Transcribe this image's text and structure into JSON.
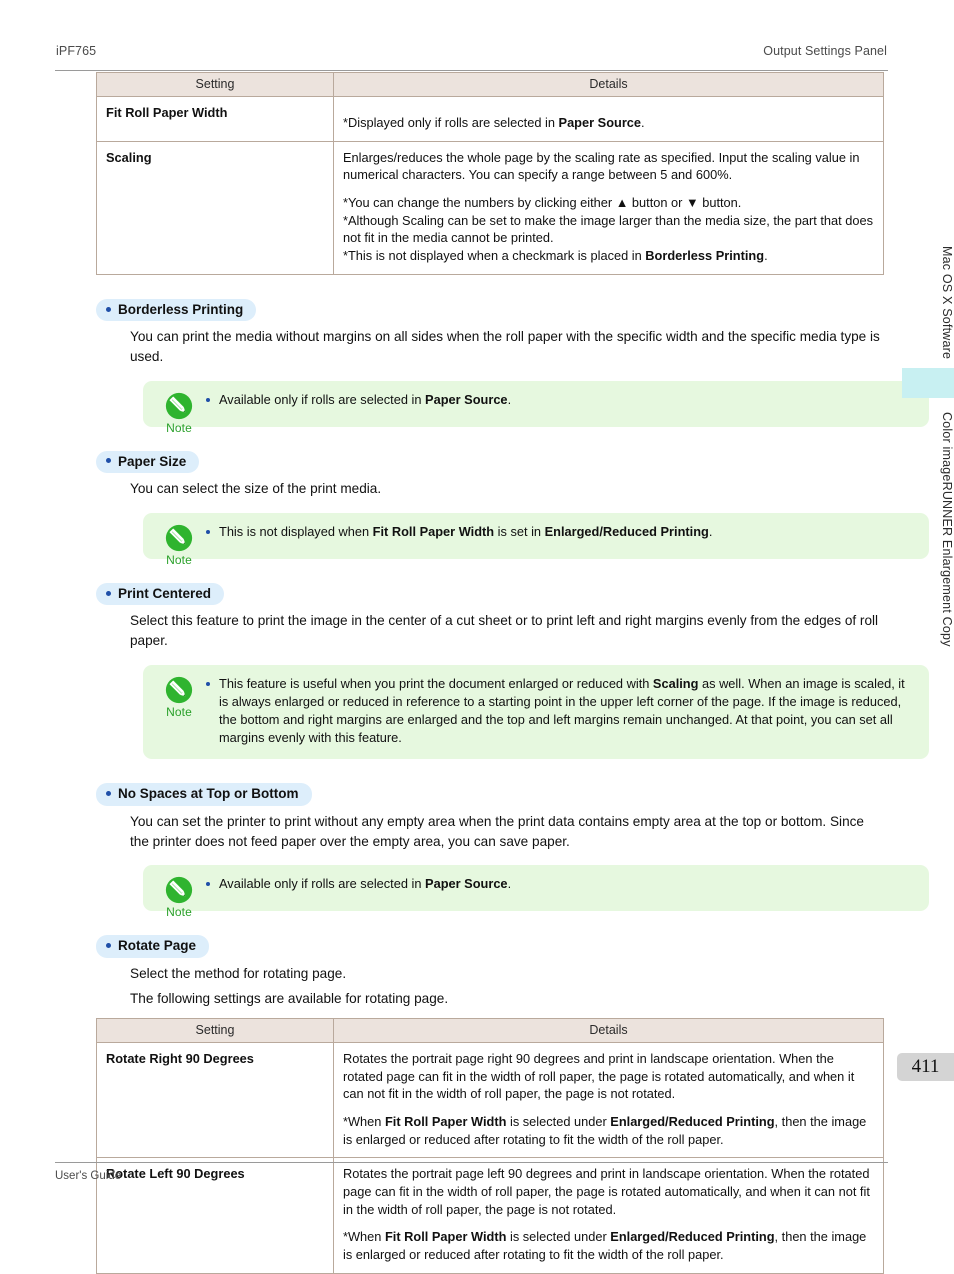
{
  "header": {
    "model": "iPF765",
    "section_title": "Output Settings Panel"
  },
  "footer": {
    "label": "User's Guide"
  },
  "side_rail": {
    "top_label": "Mac OS X Software",
    "bottom_label": "Color imageRUNNER Enlargement Copy",
    "page_number": "411",
    "tab_color": "#c8f0f2"
  },
  "table_top": {
    "columns": [
      "Setting",
      "Details"
    ],
    "rows": [
      {
        "setting": "Fit Roll Paper Width",
        "paragraphs": [
          [
            {
              "t": "*Displayed only if rolls are selected in "
            },
            {
              "t": "Paper Source",
              "b": true
            },
            {
              "t": "."
            }
          ]
        ]
      },
      {
        "setting": "Scaling",
        "paragraphs": [
          [
            {
              "t": "Enlarges/reduces the whole page by the scaling rate as specified. Input the scaling value in numerical characters. You can specify a range between 5 and 600%."
            }
          ],
          [
            {
              "t": "*You can change the numbers by clicking either ▲ button or ▼ button."
            }
          ],
          [
            {
              "t": "*Although Scaling can be set to make the image larger than the media size, the part that does not fit in the media cannot be printed."
            }
          ],
          [
            {
              "t": "*This is not displayed when a checkmark is placed in "
            },
            {
              "t": "Borderless Printing",
              "b": true
            },
            {
              "t": "."
            }
          ]
        ]
      }
    ]
  },
  "sections": [
    {
      "heading": "Borderless Printing",
      "body": "You can print the media without margins on all sides when the roll paper with the specific width and the specific media type is used.",
      "note": {
        "caption": "Note",
        "icon": "note-pencil-icon",
        "runs": [
          {
            "t": "Available only if rolls are selected in "
          },
          {
            "t": "Paper Source",
            "b": true
          },
          {
            "t": "."
          }
        ]
      }
    },
    {
      "heading": "Paper Size",
      "body": "You can select the size of the print media.",
      "note": {
        "caption": "Note",
        "icon": "note-pencil-icon",
        "runs": [
          {
            "t": "This is not displayed when "
          },
          {
            "t": "Fit Roll Paper Width",
            "b": true
          },
          {
            "t": " is set in "
          },
          {
            "t": "Enlarged/Reduced Printing",
            "b": true
          },
          {
            "t": "."
          }
        ]
      }
    },
    {
      "heading": "Print Centered",
      "body": "Select this feature to print the image in the center of a cut sheet or to print left and right margins evenly from the edges of roll paper.",
      "note": {
        "caption": "Note",
        "icon": "note-pencil-icon",
        "runs": [
          {
            "t": "This feature is useful when you print the document enlarged or reduced with "
          },
          {
            "t": "Scaling",
            "b": true
          },
          {
            "t": " as well. When an image is scaled, it is always enlarged or reduced in reference to a starting point in the upper left corner of the page. If the image is reduced, the bottom and right margins are enlarged and the top and left margins remain unchanged. At that point, you can set all margins evenly with this feature."
          }
        ]
      }
    },
    {
      "heading": "No Spaces at Top or Bottom",
      "body": "You can set the printer to print without any empty area when the print data contains empty area at the top or bottom. Since the printer does not feed paper over the empty area, you can save paper.",
      "note": {
        "caption": "Note",
        "icon": "note-pencil-icon",
        "runs": [
          {
            "t": "Available only if rolls are selected in "
          },
          {
            "t": "Paper Source",
            "b": true
          },
          {
            "t": "."
          }
        ]
      }
    },
    {
      "heading": "Rotate Page",
      "body": "Select the method for rotating page.",
      "body2": "The following settings are available for rotating page."
    }
  ],
  "table_bottom": {
    "columns": [
      "Setting",
      "Details"
    ],
    "rows": [
      {
        "setting": "Rotate Right 90 Degrees",
        "paragraphs": [
          [
            {
              "t": "Rotates the portrait page right 90 degrees and print in landscape orientation. When the rotated page can fit in the width of roll paper, the page is rotated automatically, and when it can not fit in the width of roll paper, the page is not rotated."
            }
          ],
          [
            {
              "t": "*When "
            },
            {
              "t": "Fit Roll Paper Width",
              "b": true
            },
            {
              "t": " is selected under "
            },
            {
              "t": "Enlarged/Reduced Printing",
              "b": true
            },
            {
              "t": ", then the image is enlarged or reduced after rotating to fit the width of the roll paper."
            }
          ]
        ]
      },
      {
        "setting": "Rotate Left 90 Degrees",
        "paragraphs": [
          [
            {
              "t": "Rotates the portrait page left 90 degrees and print in landscape orientation. When the rotated page can fit in the width of roll paper, the page is rotated automatically, and when it can not fit in the width of roll paper, the page is not rotated."
            }
          ],
          [
            {
              "t": "*When "
            },
            {
              "t": "Fit Roll Paper Width",
              "b": true
            },
            {
              "t": " is selected under "
            },
            {
              "t": "Enlarged/Reduced Printing",
              "b": true
            },
            {
              "t": ", then the image is enlarged or reduced after rotating to fit the width of the roll paper."
            }
          ]
        ]
      }
    ]
  },
  "colors": {
    "table_header_bg": "#ece3dd",
    "table_border": "#b9a99c",
    "pill_bg": "#ddeefb",
    "pill_dot": "#1f4fa8",
    "note_bg": "#e6f8df",
    "note_green": "#2aa02a",
    "page_badge_bg": "#d4d4d4"
  }
}
